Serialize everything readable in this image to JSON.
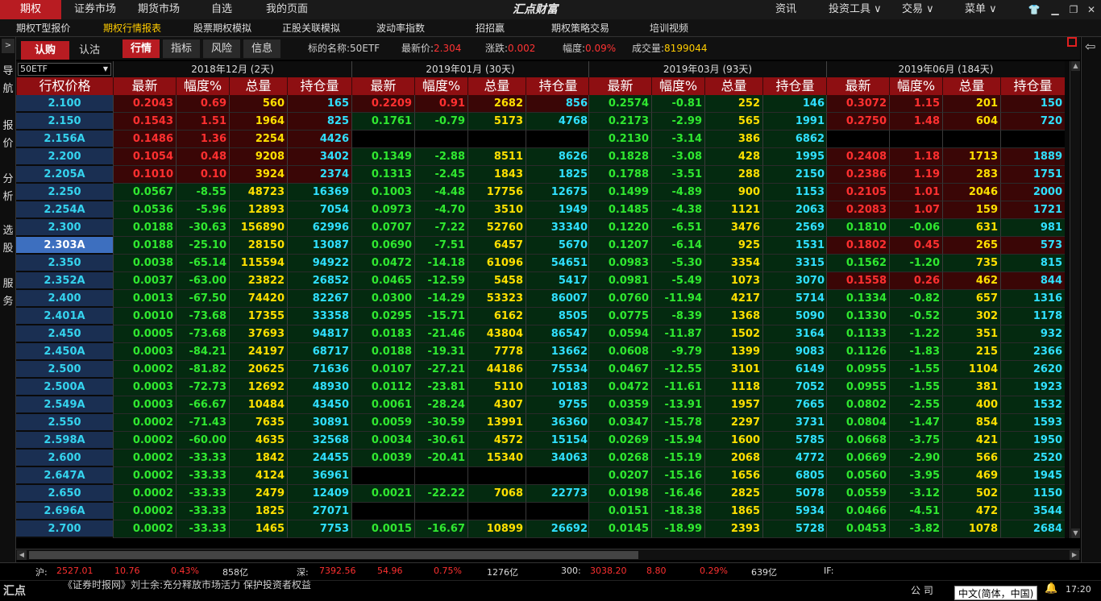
{
  "top_menu": {
    "tabs": [
      "期权",
      "证券市场",
      "期货市场",
      "自选",
      "我的页面"
    ],
    "brand": "汇点财富",
    "right_menus": [
      "资讯",
      "投资工具 ∨",
      "交易 ∨",
      "菜单 ∨"
    ]
  },
  "sub_menu": [
    "期权T型报价",
    "期权行情报表",
    "股票期权模拟",
    "正股关联模拟",
    "波动率指数",
    "招招赢",
    "期权策略交易",
    "培训视频"
  ],
  "left_nav": [
    "导航",
    "报价",
    "分析",
    "选股",
    "服务"
  ],
  "toolbar": {
    "call_label": "认购",
    "put_label": "认沽",
    "tabs": [
      "行情",
      "指标",
      "风险",
      "信息"
    ],
    "underlying_label": "标的名称:",
    "underlying_value": "50ETF",
    "last_label": "最新价:",
    "last_value": "2.304",
    "change_label": "涨跌:",
    "change_value": "0.002",
    "pct_label": "幅度:",
    "pct_value": "0.09%",
    "vol_label": "成交量:",
    "vol_value": "8199044"
  },
  "table": {
    "selector": "50ETF",
    "strike_header": "行权价格",
    "sub_headers": [
      "最新",
      "幅度%",
      "总量",
      "持仓量"
    ],
    "months": [
      "2018年12月 (2天)",
      "2019年01月 (30天)",
      "2019年03月 (93天)",
      "2019年06月 (184天)"
    ],
    "rows": [
      {
        "strike": "2.100",
        "g": [
          [
            "0.2043",
            "0.69",
            "560",
            "165"
          ],
          [
            "0.2209",
            "0.91",
            "2682",
            "856"
          ],
          [
            "0.2574",
            "-0.81",
            "252",
            "146"
          ],
          [
            "0.3072",
            "1.15",
            "201",
            "150"
          ]
        ]
      },
      {
        "strike": "2.150",
        "g": [
          [
            "0.1543",
            "1.51",
            "1964",
            "825"
          ],
          [
            "0.1761",
            "-0.79",
            "5173",
            "4768"
          ],
          [
            "0.2173",
            "-2.99",
            "565",
            "1991"
          ],
          [
            "0.2750",
            "1.48",
            "604",
            "720"
          ]
        ]
      },
      {
        "strike": "2.156A",
        "g": [
          [
            "0.1486",
            "1.36",
            "2254",
            "4426"
          ],
          null,
          [
            "0.2130",
            "-3.14",
            "386",
            "6862"
          ],
          null
        ]
      },
      {
        "strike": "2.200",
        "g": [
          [
            "0.1054",
            "0.48",
            "9208",
            "3402"
          ],
          [
            "0.1349",
            "-2.88",
            "8511",
            "8626"
          ],
          [
            "0.1828",
            "-3.08",
            "428",
            "1995"
          ],
          [
            "0.2408",
            "1.18",
            "1713",
            "1889"
          ]
        ]
      },
      {
        "strike": "2.205A",
        "g": [
          [
            "0.1010",
            "0.10",
            "3924",
            "2374"
          ],
          [
            "0.1313",
            "-2.45",
            "1843",
            "1825"
          ],
          [
            "0.1788",
            "-3.51",
            "288",
            "2150"
          ],
          [
            "0.2386",
            "1.19",
            "283",
            "1751"
          ]
        ]
      },
      {
        "strike": "2.250",
        "g": [
          [
            "0.0567",
            "-8.55",
            "48723",
            "16369"
          ],
          [
            "0.1003",
            "-4.48",
            "17756",
            "12675"
          ],
          [
            "0.1499",
            "-4.89",
            "900",
            "1153"
          ],
          [
            "0.2105",
            "1.01",
            "2046",
            "2000"
          ]
        ]
      },
      {
        "strike": "2.254A",
        "g": [
          [
            "0.0536",
            "-5.96",
            "12893",
            "7054"
          ],
          [
            "0.0973",
            "-4.70",
            "3510",
            "1949"
          ],
          [
            "0.1485",
            "-4.38",
            "1121",
            "2063"
          ],
          [
            "0.2083",
            "1.07",
            "159",
            "1721"
          ]
        ]
      },
      {
        "strike": "2.300",
        "g": [
          [
            "0.0188",
            "-30.63",
            "156890",
            "62996"
          ],
          [
            "0.0707",
            "-7.22",
            "52760",
            "33340"
          ],
          [
            "0.1220",
            "-6.51",
            "3476",
            "2569"
          ],
          [
            "0.1810",
            "-0.06",
            "631",
            "981"
          ]
        ]
      },
      {
        "strike": "2.303A",
        "g": [
          [
            "0.0188",
            "-25.10",
            "28150",
            "13087"
          ],
          [
            "0.0690",
            "-7.51",
            "6457",
            "5670"
          ],
          [
            "0.1207",
            "-6.14",
            "925",
            "1531"
          ],
          [
            "0.1802",
            "0.45",
            "265",
            "573"
          ]
        ]
      },
      {
        "strike": "2.350",
        "g": [
          [
            "0.0038",
            "-65.14",
            "115594",
            "94922"
          ],
          [
            "0.0472",
            "-14.18",
            "61096",
            "54651"
          ],
          [
            "0.0983",
            "-5.30",
            "3354",
            "3315"
          ],
          [
            "0.1562",
            "-1.20",
            "735",
            "815"
          ]
        ]
      },
      {
        "strike": "2.352A",
        "g": [
          [
            "0.0037",
            "-63.00",
            "23822",
            "26852"
          ],
          [
            "0.0465",
            "-12.59",
            "5458",
            "5417"
          ],
          [
            "0.0981",
            "-5.49",
            "1073",
            "3070"
          ],
          [
            "0.1558",
            "0.26",
            "462",
            "844"
          ]
        ]
      },
      {
        "strike": "2.400",
        "g": [
          [
            "0.0013",
            "-67.50",
            "74420",
            "82267"
          ],
          [
            "0.0300",
            "-14.29",
            "53323",
            "86007"
          ],
          [
            "0.0760",
            "-11.94",
            "4217",
            "5714"
          ],
          [
            "0.1334",
            "-0.82",
            "657",
            "1316"
          ]
        ]
      },
      {
        "strike": "2.401A",
        "g": [
          [
            "0.0010",
            "-73.68",
            "17355",
            "33358"
          ],
          [
            "0.0295",
            "-15.71",
            "6162",
            "8505"
          ],
          [
            "0.0775",
            "-8.39",
            "1368",
            "5090"
          ],
          [
            "0.1330",
            "-0.52",
            "302",
            "1178"
          ]
        ]
      },
      {
        "strike": "2.450",
        "g": [
          [
            "0.0005",
            "-73.68",
            "37693",
            "94817"
          ],
          [
            "0.0183",
            "-21.46",
            "43804",
            "86547"
          ],
          [
            "0.0594",
            "-11.87",
            "1502",
            "3164"
          ],
          [
            "0.1133",
            "-1.22",
            "351",
            "932"
          ]
        ]
      },
      {
        "strike": "2.450A",
        "g": [
          [
            "0.0003",
            "-84.21",
            "24197",
            "68717"
          ],
          [
            "0.0188",
            "-19.31",
            "7778",
            "13662"
          ],
          [
            "0.0608",
            "-9.79",
            "1399",
            "9083"
          ],
          [
            "0.1126",
            "-1.83",
            "215",
            "2366"
          ]
        ]
      },
      {
        "strike": "2.500",
        "g": [
          [
            "0.0002",
            "-81.82",
            "20625",
            "71636"
          ],
          [
            "0.0107",
            "-27.21",
            "44186",
            "75534"
          ],
          [
            "0.0467",
            "-12.55",
            "3101",
            "6149"
          ],
          [
            "0.0955",
            "-1.55",
            "1104",
            "2620"
          ]
        ]
      },
      {
        "strike": "2.500A",
        "g": [
          [
            "0.0003",
            "-72.73",
            "12692",
            "48930"
          ],
          [
            "0.0112",
            "-23.81",
            "5110",
            "10183"
          ],
          [
            "0.0472",
            "-11.61",
            "1118",
            "7052"
          ],
          [
            "0.0955",
            "-1.55",
            "381",
            "1923"
          ]
        ]
      },
      {
        "strike": "2.549A",
        "g": [
          [
            "0.0003",
            "-66.67",
            "10484",
            "43450"
          ],
          [
            "0.0061",
            "-28.24",
            "4307",
            "9755"
          ],
          [
            "0.0359",
            "-13.91",
            "1957",
            "7665"
          ],
          [
            "0.0802",
            "-2.55",
            "400",
            "1532"
          ]
        ]
      },
      {
        "strike": "2.550",
        "g": [
          [
            "0.0002",
            "-71.43",
            "7635",
            "30891"
          ],
          [
            "0.0059",
            "-30.59",
            "13991",
            "36360"
          ],
          [
            "0.0347",
            "-15.78",
            "2297",
            "3731"
          ],
          [
            "0.0804",
            "-1.47",
            "854",
            "1593"
          ]
        ]
      },
      {
        "strike": "2.598A",
        "g": [
          [
            "0.0002",
            "-60.00",
            "4635",
            "32568"
          ],
          [
            "0.0034",
            "-30.61",
            "4572",
            "15154"
          ],
          [
            "0.0269",
            "-15.94",
            "1600",
            "5785"
          ],
          [
            "0.0668",
            "-3.75",
            "421",
            "1950"
          ]
        ]
      },
      {
        "strike": "2.600",
        "g": [
          [
            "0.0002",
            "-33.33",
            "1842",
            "24455"
          ],
          [
            "0.0039",
            "-20.41",
            "15340",
            "34063"
          ],
          [
            "0.0268",
            "-15.19",
            "2068",
            "4772"
          ],
          [
            "0.0669",
            "-2.90",
            "566",
            "2520"
          ]
        ]
      },
      {
        "strike": "2.647A",
        "g": [
          [
            "0.0002",
            "-33.33",
            "4124",
            "36961"
          ],
          null,
          [
            "0.0207",
            "-15.16",
            "1656",
            "6805"
          ],
          [
            "0.0560",
            "-3.95",
            "469",
            "1945"
          ]
        ]
      },
      {
        "strike": "2.650",
        "g": [
          [
            "0.0002",
            "-33.33",
            "2479",
            "12409"
          ],
          [
            "0.0021",
            "-22.22",
            "7068",
            "22773"
          ],
          [
            "0.0198",
            "-16.46",
            "2825",
            "5078"
          ],
          [
            "0.0559",
            "-3.12",
            "502",
            "1150"
          ]
        ]
      },
      {
        "strike": "2.696A",
        "g": [
          [
            "0.0002",
            "-33.33",
            "1825",
            "27071"
          ],
          null,
          [
            "0.0151",
            "-18.38",
            "1865",
            "5934"
          ],
          [
            "0.0466",
            "-4.51",
            "472",
            "3544"
          ]
        ]
      },
      {
        "strike": "2.700",
        "g": [
          [
            "0.0002",
            "-33.33",
            "1465",
            "7753"
          ],
          [
            "0.0015",
            "-16.67",
            "10899",
            "26692"
          ],
          [
            "0.0145",
            "-18.99",
            "2393",
            "5728"
          ],
          [
            "0.0453",
            "-3.82",
            "1078",
            "2684"
          ]
        ]
      }
    ],
    "selected_row": 8
  },
  "index_bar": {
    "sh_label": "沪:",
    "sh_value": "2527.01",
    "sh_change": "10.76",
    "sh_pct": "0.43%",
    "sh_amt": "858亿",
    "sz_label": "深:",
    "sz_value": "7392.56",
    "sz_change": "54.96",
    "sz_pct": "0.75%",
    "sz_amt": "1276亿",
    "hs300_label": "300:",
    "hs300_value": "3038.20",
    "hs300_change": "8.80",
    "hs300_pct": "0.29%",
    "hs300_amt": "639亿",
    "if_label": "IF:"
  },
  "status_bar": {
    "logo": "汇点",
    "news": "《证券时报网》刘士余:充分释放市场活力 保护投资者权益",
    "company": "公 司",
    "ime": "中文(简体，中国)",
    "time": "17:20"
  },
  "colors": {
    "up": "#ff3030",
    "down": "#30e830",
    "vol": "#ffe000",
    "oi": "#30e0ff",
    "header": "#8e0f12",
    "strike_bg": "#1a2f52",
    "selected": "#3d6fbf"
  }
}
